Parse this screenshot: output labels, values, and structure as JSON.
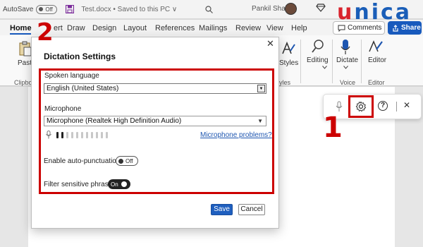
{
  "titlebar": {
    "autosave_label": "AutoSave",
    "autosave_state": "Off",
    "doc_name": "Test.docx • Saved to this PC ∨",
    "user_name": "Pankil Shah"
  },
  "logo": {
    "first": "u",
    "second": "nica"
  },
  "menu": {
    "tabs": [
      "Home",
      "ert",
      "Draw",
      "Design",
      "Layout",
      "References",
      "Mailings",
      "Review",
      "View",
      "Help"
    ],
    "comments_label": "Comments",
    "share_label": "Share"
  },
  "ribbon": {
    "paste_label": "Paste",
    "clipboard_label": "Clipbo",
    "styles_label": "Styles",
    "styles_group_label": "yles",
    "editing_label": "Editing",
    "dictate_label": "Dictate",
    "editor_label": "Editor",
    "voice_group_label": "Voice",
    "editor_group_label": "Editor"
  },
  "annotations": {
    "one": "1",
    "two": "2"
  },
  "dialog": {
    "title": "Dictation Settings",
    "spoken_language_label": "Spoken language",
    "spoken_language_value": "English (United States)",
    "microphone_label": "Microphone",
    "microphone_value": "Microphone (Realtek High Definition Audio)",
    "microphone_problems_link": "Microphone problems?",
    "level_bars_total": 11,
    "level_bars_active": 2,
    "auto_punct_label": "Enable auto-punctuation",
    "auto_punct_state": "Off",
    "filter_label": "Filter sensitive phrases",
    "filter_state": "On",
    "save_label": "Save",
    "cancel_label": "Cancel"
  },
  "colors": {
    "accent": "#185abd",
    "highlight": "#cc0000",
    "logo_blue": "#1a5eb8",
    "logo_red": "#d9232d"
  }
}
